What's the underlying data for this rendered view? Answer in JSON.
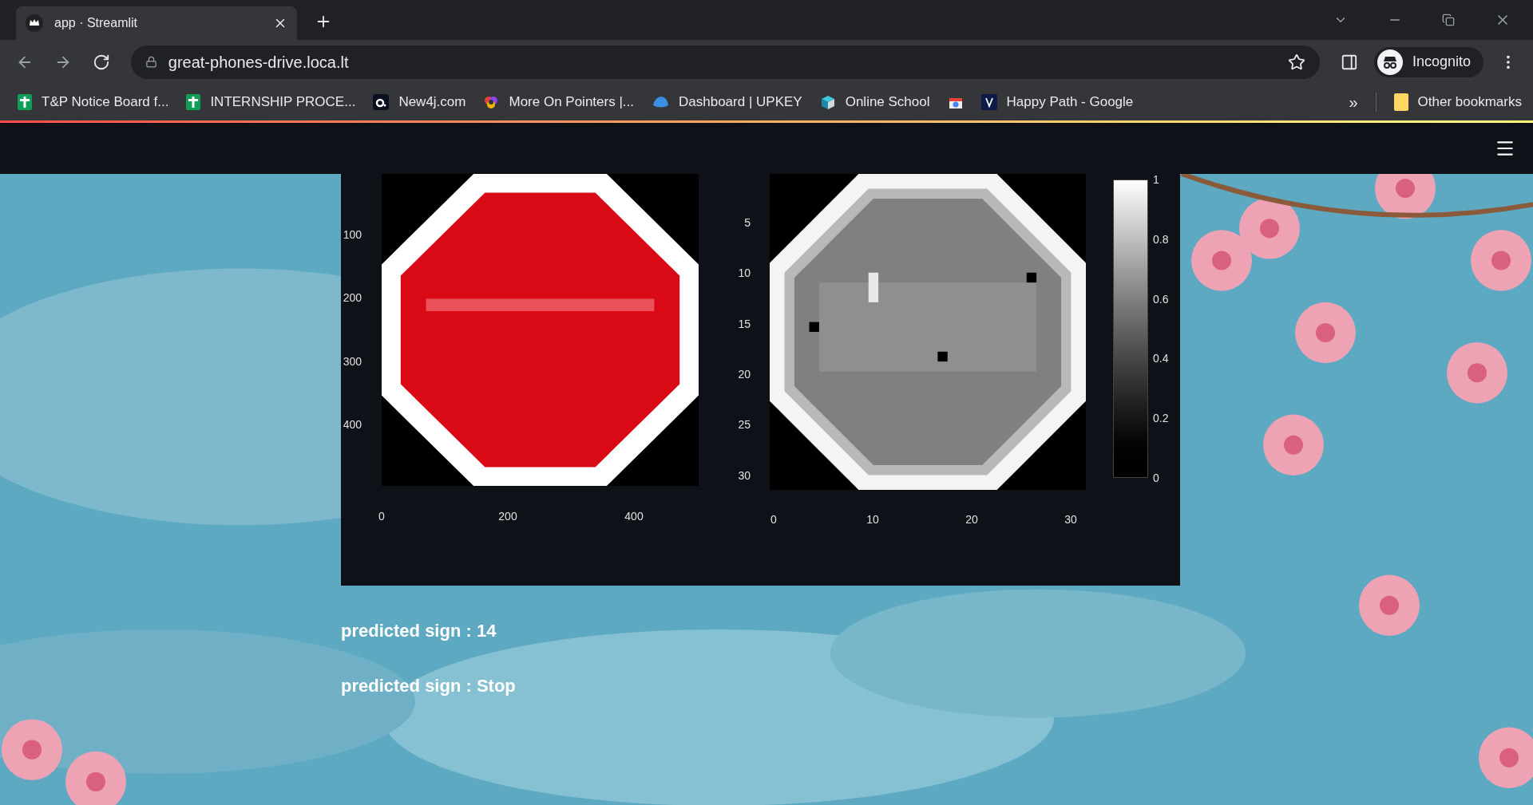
{
  "browser": {
    "tab": {
      "title": "app · Streamlit"
    },
    "url": "great-phones-drive.loca.lt",
    "profile": "Incognito",
    "bookmarks": [
      {
        "label": "T&P Notice Board f...",
        "kind": "sheet"
      },
      {
        "label": "INTERNSHIP PROCE...",
        "kind": "sheet"
      },
      {
        "label": "New4j.com",
        "kind": "dark"
      },
      {
        "label": "More On Pointers |...",
        "kind": "swirl"
      },
      {
        "label": "Dashboard | UPKEY",
        "kind": "cloud"
      },
      {
        "label": "Online School",
        "kind": "cube"
      },
      {
        "kind": "store"
      },
      {
        "label": "Happy Path - Google",
        "kind": "v"
      }
    ],
    "more": "»",
    "other": "Other bookmarks"
  },
  "figure": {
    "image_plot": {
      "yticks": [
        "100",
        "200",
        "300",
        "400"
      ],
      "xticks": [
        "0",
        "200",
        "400"
      ]
    },
    "gray_plot": {
      "yticks": [
        "5",
        "10",
        "15",
        "20",
        "25",
        "30"
      ],
      "xticks": [
        "0",
        "10",
        "20",
        "30"
      ]
    },
    "colorbar": {
      "ticks": [
        "1",
        "0.8",
        "0.6",
        "0.4",
        "0.2",
        "0"
      ]
    }
  },
  "results": [
    "predicted sign : 14",
    "predicted sign : Stop"
  ]
}
